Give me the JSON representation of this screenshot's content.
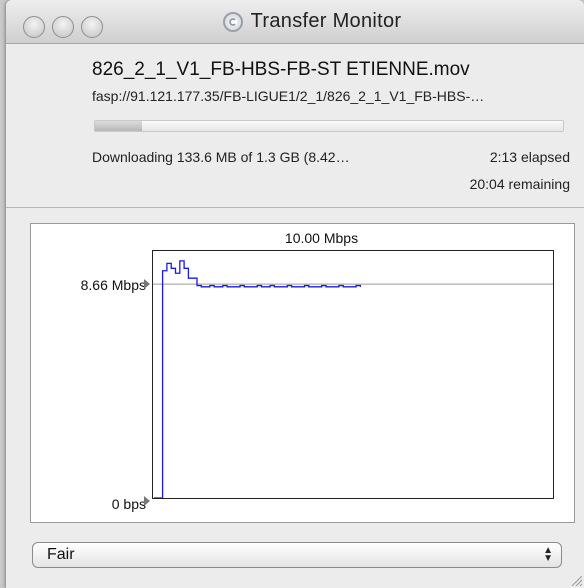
{
  "window": {
    "title": "Transfer Monitor",
    "app_icon": "transfer-app-icon"
  },
  "transfer": {
    "filename": "826_2_1_V1_FB-HBS-FB-ST ETIENNE.mov",
    "url": "fasp://91.121.177.35/FB-LIGUE1/2_1/826_2_1_V1_FB-HBS-…",
    "progress_fraction": 0.1,
    "status": "Downloading 133.6 MB of 1.3 GB (8.42…",
    "elapsed": "2:13 elapsed",
    "remaining": "20:04 remaining"
  },
  "graph": {
    "max_label": "10.00 Mbps",
    "target_label": "8.66 Mbps",
    "min_label": "0 bps",
    "y_max": 10.0,
    "target_value": 8.66,
    "line_color": "#1a1ae6",
    "target_line_color": "#9a9a9a",
    "series": [
      0,
      0,
      9.2,
      9.5,
      9.3,
      9.1,
      9.6,
      9.3,
      8.9,
      8.9,
      8.6,
      8.55,
      8.55,
      8.6,
      8.55,
      8.55,
      8.6,
      8.55,
      8.55,
      8.55,
      8.6,
      8.55,
      8.55,
      8.55,
      8.6,
      8.55,
      8.55,
      8.6,
      8.55,
      8.55,
      8.55,
      8.6,
      8.55,
      8.55,
      8.55,
      8.6,
      8.55,
      8.55,
      8.55,
      8.6,
      8.55,
      8.55,
      8.55,
      8.6,
      8.55,
      8.55,
      8.55,
      8.6,
      8.55
    ]
  },
  "policy": {
    "selected": "Fair",
    "arrows_icon": "up-down-arrows-icon"
  }
}
